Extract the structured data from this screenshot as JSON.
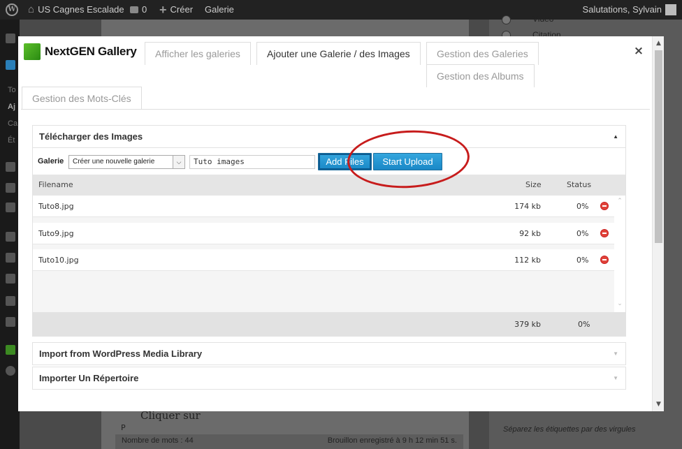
{
  "adminbar": {
    "site_name": "US Cagnes Escalade",
    "comments_count": "0",
    "new_label": "Créer",
    "gallery_label": "Galerie",
    "greeting": "Salutations, Sylvain"
  },
  "background": {
    "sidebar_letters": [
      "To",
      "Aj",
      "Ca",
      "Ét"
    ],
    "editor_text": "Cliquer sur",
    "editor_path": "P",
    "word_count": "Nombre de mots : 44",
    "draft_saved": "Brouillon enregistré à 9 h 12 min 51 s.",
    "format_options": [
      "Vidéo",
      "Citation"
    ],
    "tags_hint": "Séparez les étiquettes par des virgules"
  },
  "modal": {
    "logo_text": "NextGEN Gallery",
    "tabs": [
      {
        "label": "Afficher les galeries",
        "active": false
      },
      {
        "label": "Ajouter une Galerie / des Images",
        "active": true
      },
      {
        "label": "Gestion des Galeries",
        "active": false
      },
      {
        "label": "Gestion des Albums",
        "active": false
      },
      {
        "label": "Gestion des Mots-Clés",
        "active": false
      }
    ],
    "close_symbol": "×"
  },
  "upload": {
    "title": "Télécharger des Images",
    "gallery_label": "Galerie",
    "gallery_select_value": "Créer une nouvelle galerie",
    "gallery_name_value": "Tuto images",
    "add_files_label": "Add Files",
    "start_upload_label": "Start Upload",
    "columns": {
      "filename": "Filename",
      "size": "Size",
      "status": "Status"
    },
    "files": [
      {
        "name": "Tuto8.jpg",
        "size": "174 kb",
        "status": "0%"
      },
      {
        "name": "Tuto9.jpg",
        "size": "92 kb",
        "status": "0%"
      },
      {
        "name": "Tuto10.jpg",
        "size": "112 kb",
        "status": "0%"
      }
    ],
    "total_size": "379 kb",
    "total_status": "0%"
  },
  "panels": {
    "import_media": "Import from WordPress Media Library",
    "import_folder": "Importer Un Répertoire"
  },
  "colors": {
    "accent_blue": "#1a88c7",
    "annotation_red": "#c71c1c",
    "remove_red": "#e0433a"
  }
}
